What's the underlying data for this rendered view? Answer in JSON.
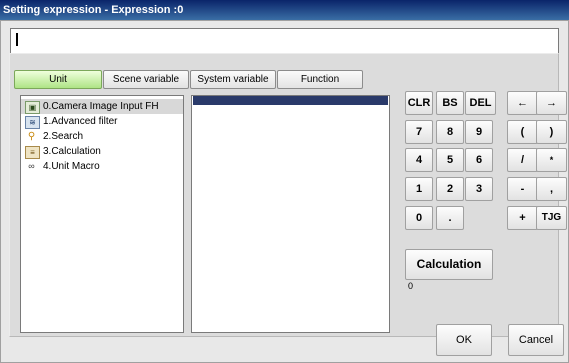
{
  "window": {
    "title": "Setting expression - Expression :0"
  },
  "expression": {
    "value": ""
  },
  "tabs": [
    {
      "label": "Unit",
      "active": true
    },
    {
      "label": "Scene variable",
      "active": false
    },
    {
      "label": "System variable",
      "active": false
    },
    {
      "label": "Function",
      "active": false
    }
  ],
  "units": [
    {
      "label": "0.Camera Image Input FH",
      "icon": "camera-icon",
      "selected": true
    },
    {
      "label": "1.Advanced filter",
      "icon": "filter-icon",
      "selected": false
    },
    {
      "label": "2.Search",
      "icon": "search-icon",
      "selected": false
    },
    {
      "label": "3.Calculation",
      "icon": "calculator-icon",
      "selected": false
    },
    {
      "label": "4.Unit Macro",
      "icon": "macro-icon",
      "selected": false
    }
  ],
  "keypad": {
    "clr": "CLR",
    "bs": "BS",
    "del": "DEL",
    "left": "←",
    "right": "→",
    "k7": "7",
    "k8": "8",
    "k9": "9",
    "lparen": "(",
    "rparen": ")",
    "k4": "4",
    "k5": "5",
    "k6": "6",
    "div": "/",
    "mul": "*",
    "k1": "1",
    "k2": "2",
    "k3": "3",
    "minus": "-",
    "comma": ",",
    "k0": "0",
    "dot": ".",
    "plus": "+",
    "tjg": "TJG"
  },
  "calculation": {
    "label": "Calculation",
    "result": "0"
  },
  "footer": {
    "ok": "OK",
    "cancel": "Cancel"
  },
  "colors": {
    "title_bar": "#0a246a",
    "active_tab": "#aee486",
    "list_selection": "#2a3a6a"
  }
}
